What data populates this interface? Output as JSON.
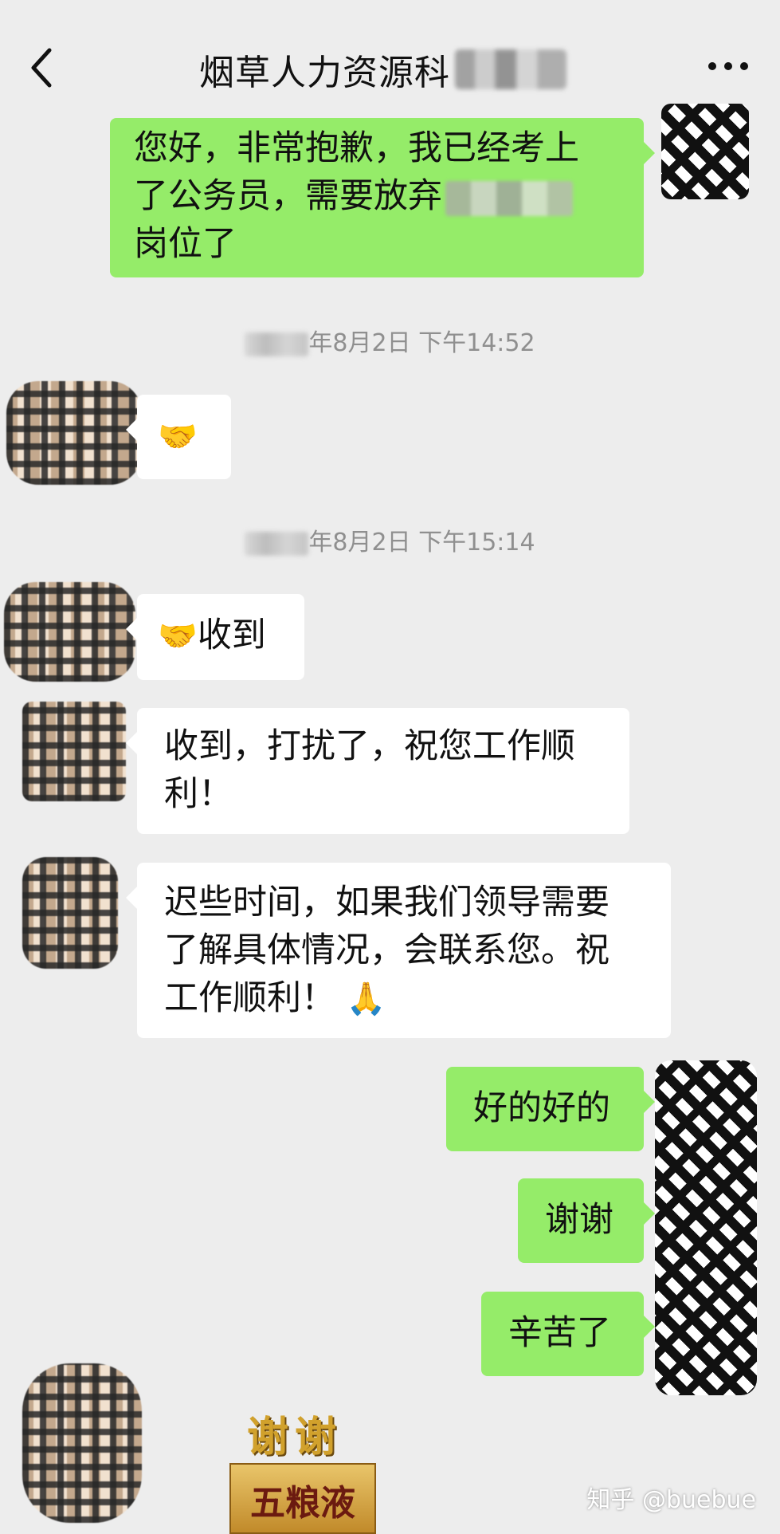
{
  "header": {
    "back_icon": "chevron-left-icon",
    "title": "烟草人力资源科",
    "more_icon": "more-horizontal-icon"
  },
  "messages": [
    {
      "side": "right",
      "text_lines": [
        "您好，非常抱歉，我已经考上",
        "了公务员，需要放弃",
        "岗位了"
      ]
    },
    {
      "type": "time",
      "text": "年8月2日 下午14:52"
    },
    {
      "side": "left",
      "emoji": "🤝"
    },
    {
      "type": "time",
      "text": "年8月2日 下午15:14"
    },
    {
      "side": "left",
      "emoji": "🤝",
      "text": "收到"
    },
    {
      "side": "left",
      "text_lines": [
        "收到，打扰了，祝您工作顺",
        "利！"
      ]
    },
    {
      "side": "left",
      "text_lines": [
        "迟些时间，如果我们领导需要",
        "了解具体情况，会联系您。祝",
        "工作顺利！"
      ],
      "emoji": "🙏"
    },
    {
      "side": "right",
      "text": "好的好的"
    },
    {
      "side": "right",
      "text": "谢谢"
    },
    {
      "side": "right",
      "text": "辛苦了"
    }
  ],
  "sticker": {
    "top_text": "谢谢",
    "brand_text": "五粮液"
  },
  "watermark": "知乎 @buebue",
  "colors": {
    "background": "#ededed",
    "green_bubble": "#95ec69",
    "white_bubble": "#ffffff"
  }
}
